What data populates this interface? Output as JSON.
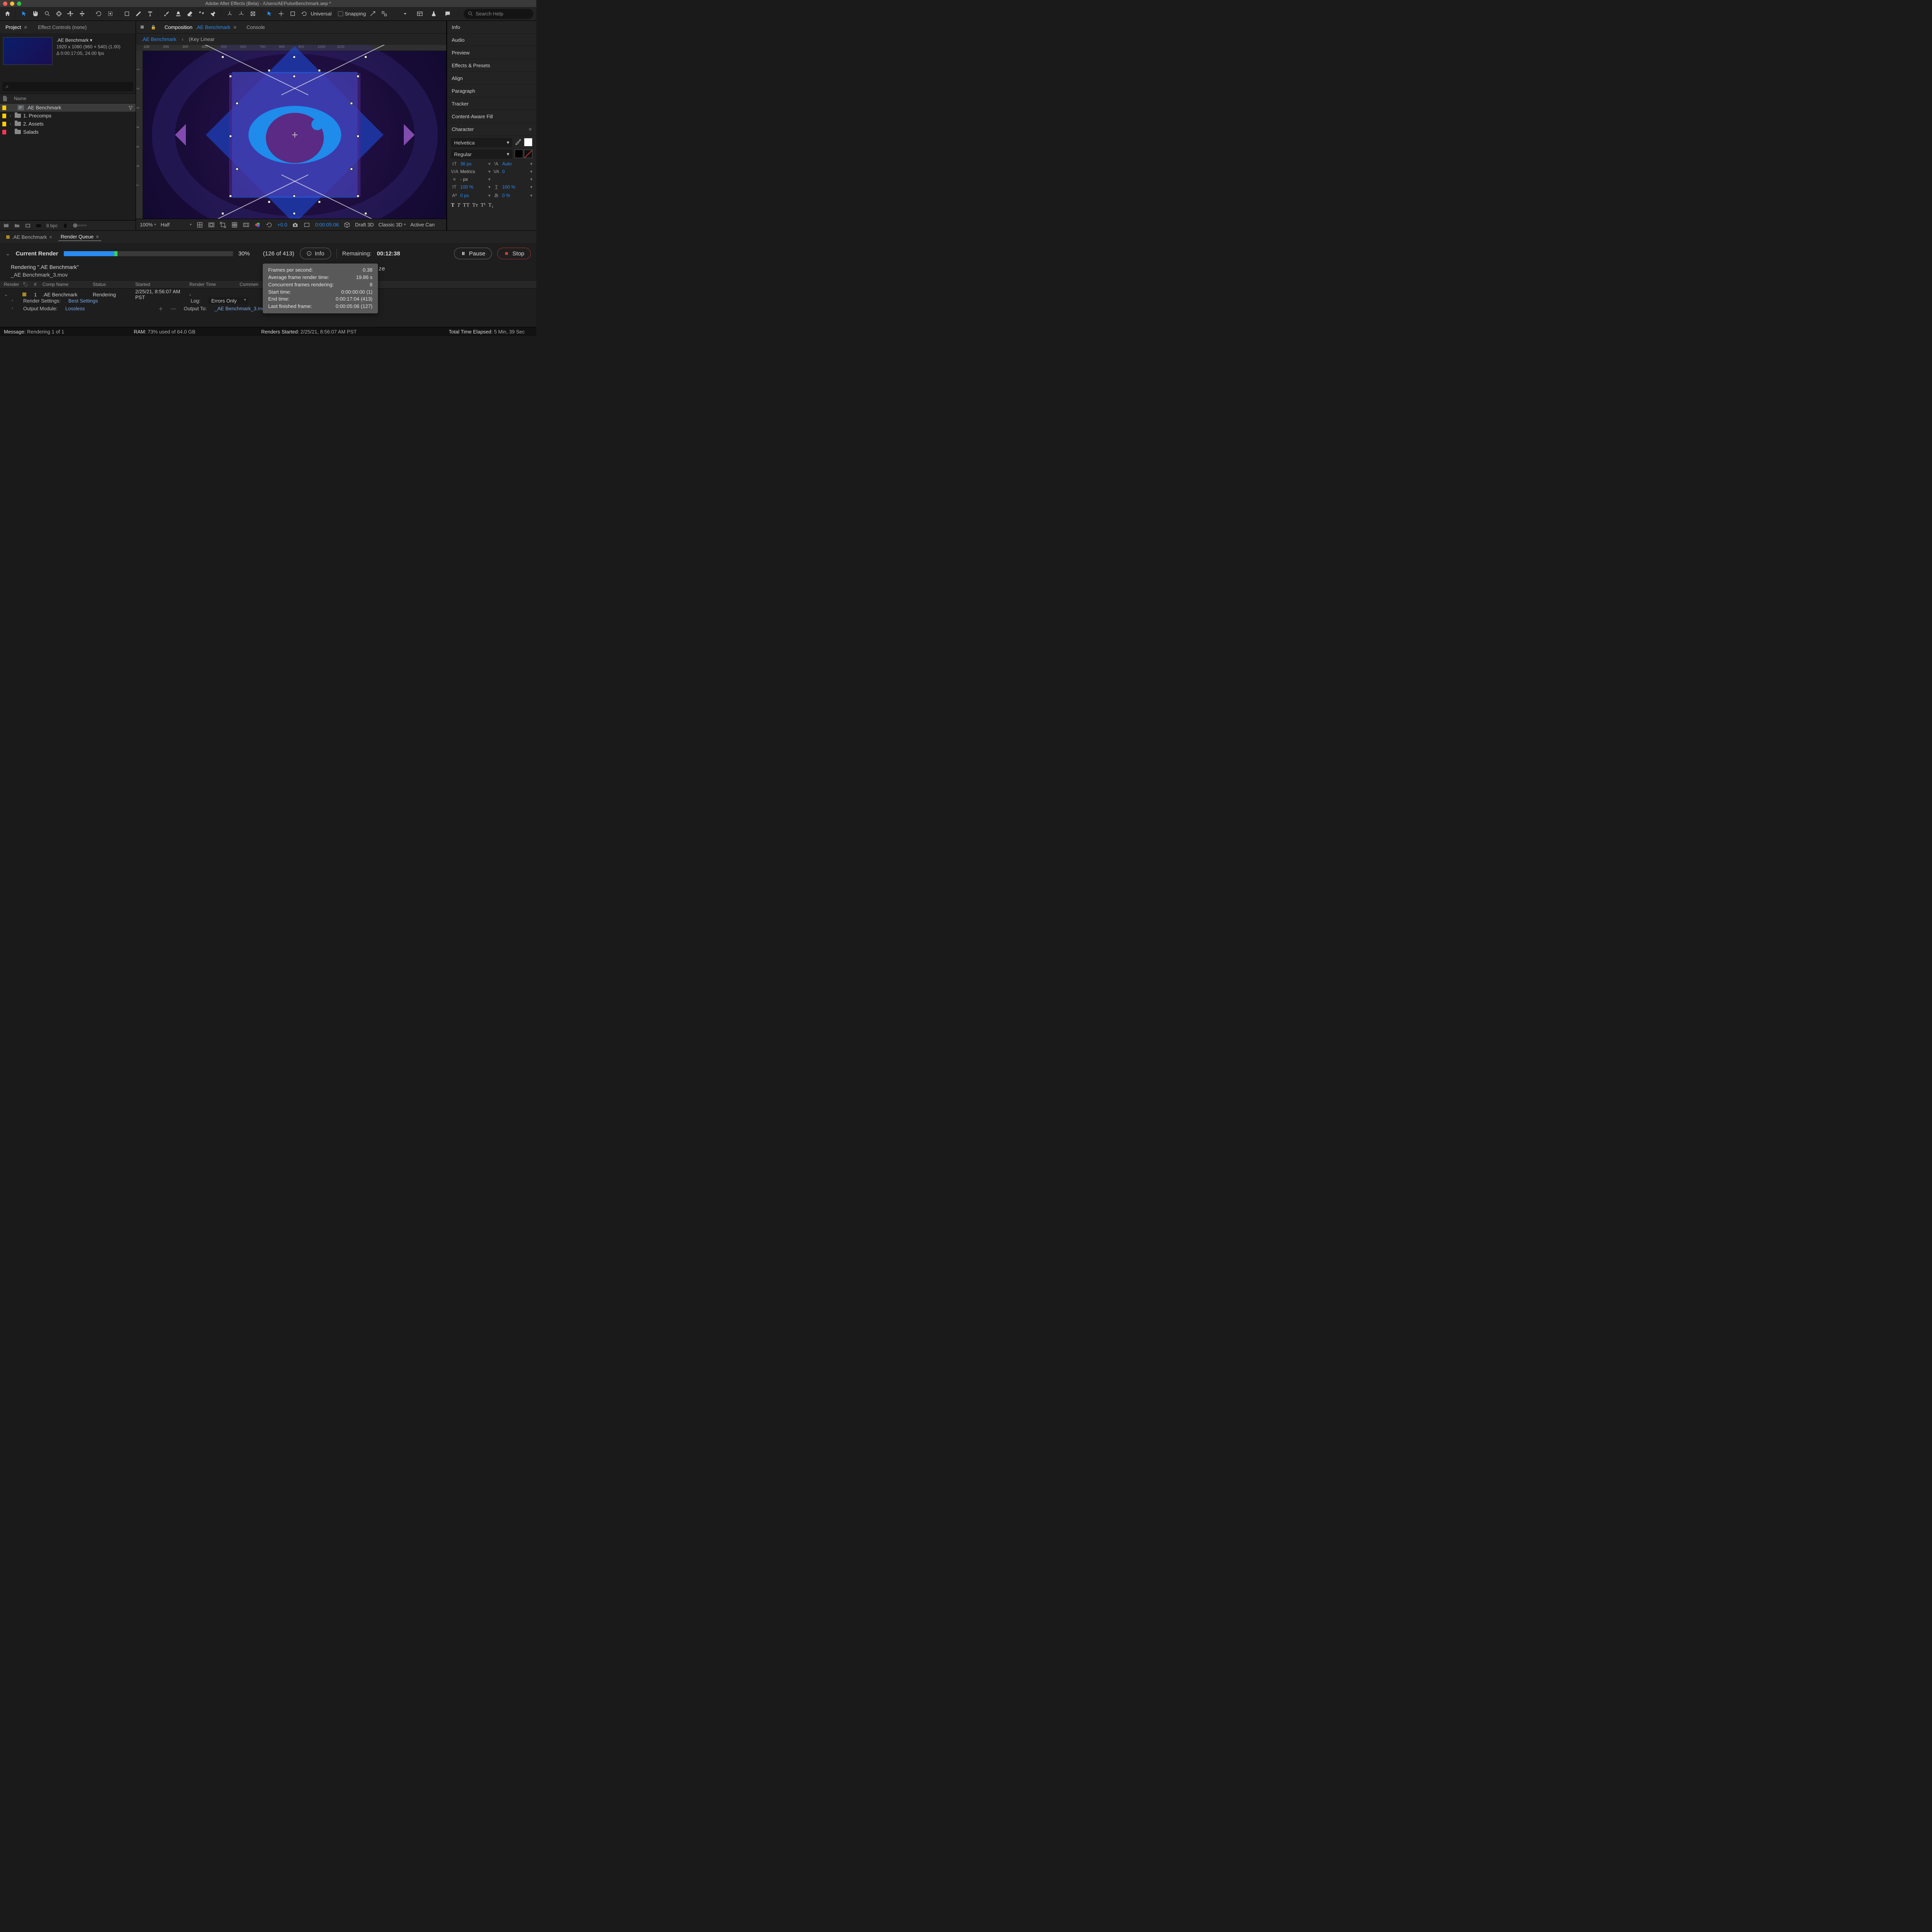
{
  "window": {
    "title": "Adobe After Effects (Beta) - /Users/AEPulseBenchmark.aep *"
  },
  "toolbar": {
    "universal": "Universal",
    "snapping": "Snapping",
    "search_placeholder": "Search Help"
  },
  "project_panel": {
    "tab_project": "Project",
    "tab_effects": "Effect Controls (none)",
    "comp_name": ".AE Benchmark",
    "comp_dims": "1920 x 1080  (960 × 540) (1.00)",
    "comp_dur": "Δ 0:00:17:05, 24.00 fps",
    "search_placeholder": "⌕",
    "col_name": "Name",
    "tree": [
      {
        "swatch": "yellow",
        "name": ".AE Benchmark",
        "type": "comp",
        "selected": true,
        "flow": true
      },
      {
        "swatch": "yellow",
        "name": "1. Precomps",
        "type": "folder",
        "expand": true
      },
      {
        "swatch": "yellow",
        "name": "2. Assets",
        "type": "folder",
        "expand": true
      },
      {
        "swatch": "red",
        "name": "Salads",
        "type": "folder",
        "expand": false
      }
    ],
    "footer_bpc": "8 bpc"
  },
  "comp_panel": {
    "tab_label": "Composition",
    "tab_link": ".AE Benchmark",
    "tab_console": "Console",
    "sub_link": ".AE Benchmark",
    "sub_right": "(Key Linear",
    "ruler_h": [
      "100",
      "200",
      "300",
      "400",
      "500",
      "600",
      "700",
      "800",
      "900",
      "1000",
      "1100"
    ],
    "ruler_v": [
      "1",
      "2",
      "3",
      "4",
      "5",
      "6",
      "7"
    ],
    "footer": {
      "zoom": "100%",
      "res": "Half",
      "exposure": "+0.0",
      "timecode": "0:00:05:06",
      "draft3d": "Draft 3D",
      "renderer": "Classic 3D",
      "activecam": "Active Can"
    }
  },
  "right_panel": {
    "items": [
      "Info",
      "Audio",
      "Preview",
      "Effects & Presets",
      "Align",
      "Paragraph",
      "Tracker",
      "Content-Aware Fill"
    ],
    "character_title": "Character",
    "font": "Helvetica",
    "style": "Regular",
    "size": "36 px",
    "leading": "Auto",
    "kerning": "Metrics",
    "tracking": "0",
    "stroke": "- px",
    "scaleH": "100 %",
    "scaleV": "100 %",
    "baseline": "0 px",
    "tsume": "0 %"
  },
  "render": {
    "tab1": ".AE Benchmark",
    "tab2": "Render Queue",
    "label": "Current Render",
    "pct": "30%",
    "progress_pct": 30,
    "countof": "(126 of 413)",
    "info": "Info",
    "remaining_label": "Remaining:",
    "remaining_val": "00:12:38",
    "pause": "Pause",
    "stop": "Stop",
    "line1": "Rendering \".AE Benchmark\"",
    "line2": "_AE Benchmark_3.mov",
    "rest_ze": "ze",
    "cols": {
      "render": "Render",
      "num": "#",
      "comp": "Comp Name",
      "status": "Status",
      "started": "Started",
      "rendertime": "Render Time",
      "comment": "Commen"
    },
    "row": {
      "num": "1",
      "comp": ".AE Benchmark",
      "status": "Rendering",
      "started": "2/25/21, 8:56:07 AM PST",
      "rendertime": "-"
    },
    "settings": {
      "rs_label": "Render Settings:",
      "rs_val": "Best Settings",
      "om_label": "Output Module:",
      "om_val": "Lossless",
      "log_label": "Log:",
      "log_val": "Errors Only",
      "out_label": "Output To:",
      "out_val": "_AE Benchmark_3.mov"
    }
  },
  "tooltip": {
    "l1": "Frames per second:",
    "v1": "0.38",
    "l2": "Average frame render time:",
    "v2": "19.86 s",
    "l3": "Concurrent frames rendering:",
    "v3": "8",
    "l4": "Start time:",
    "v4": "0:00:00:00 (1)",
    "l5": "End time:",
    "v5": "0:00:17:04 (413)",
    "l6": "Last finished frame:",
    "v6": "0:00:05:06 (127)"
  },
  "status": {
    "msg_l": "Message:",
    "msg_v": "Rendering 1 of 1",
    "ram_l": "RAM:",
    "ram_v": "73% used of 64.0 GB",
    "start_l": "Renders Started:",
    "start_v": "2/25/21, 8:56:07 AM PST",
    "elapsed_l": "Total Time Elapsed:",
    "elapsed_v": "5 Min, 39 Sec"
  }
}
